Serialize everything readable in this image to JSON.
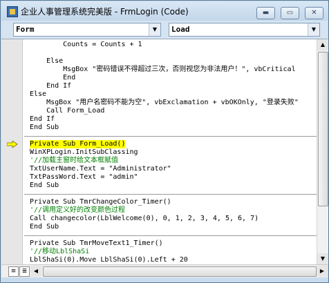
{
  "window": {
    "title": "企业人事管理系统完美版 - FrmLogin (Code)",
    "buttons": {
      "minimize": "▬",
      "restore": "▭",
      "close": "✕"
    }
  },
  "combos": {
    "object": {
      "value": "Form",
      "arrow": "▼"
    },
    "procedure": {
      "value": "Load",
      "arrow": "▼"
    }
  },
  "code_lines": [
    {
      "text": "        Counts = Counts + 1",
      "style": ""
    },
    {
      "text": "",
      "style": ""
    },
    {
      "text": "    Else",
      "style": ""
    },
    {
      "text": "        MsgBox \"密码错误不得超过三次，否则视您为非法用户！\", vbCritical",
      "style": ""
    },
    {
      "text": "        End",
      "style": ""
    },
    {
      "text": "    End If",
      "style": ""
    },
    {
      "text": "Else",
      "style": ""
    },
    {
      "text": "    MsgBox \"用户名密码不能为空\", vbExclamation + vbOKOnly, \"登录失败\"",
      "style": ""
    },
    {
      "text": "    Call Form_Load",
      "style": ""
    },
    {
      "text": "End If",
      "style": ""
    },
    {
      "text": "End Sub",
      "style": ""
    },
    {
      "text": "",
      "style": "sep"
    },
    {
      "text": "Private Sub Form_Load()",
      "style": "hl"
    },
    {
      "text": "WinXPLogin.InitSubClassing",
      "style": ""
    },
    {
      "text": "'//加载主窗时给文本框赋值",
      "style": "green"
    },
    {
      "text": "TxtUserName.Text = \"Administrator\"",
      "style": ""
    },
    {
      "text": "TxtPassWord.Text = \"admin\"",
      "style": ""
    },
    {
      "text": "End Sub",
      "style": ""
    },
    {
      "text": "",
      "style": "sep"
    },
    {
      "text": "Private Sub TmrChangeColor_Timer()",
      "style": ""
    },
    {
      "text": "'//调用定义好的改变颜色过程",
      "style": "green"
    },
    {
      "text": "Call changecolor(LblWelcome(0), 0, 1, 2, 3, 4, 5, 6, 7)",
      "style": ""
    },
    {
      "text": "End Sub",
      "style": ""
    },
    {
      "text": "",
      "style": "sep"
    },
    {
      "text": "Private Sub TmrMoveText1_Timer()",
      "style": ""
    },
    {
      "text": "'//移动LblShaSi",
      "style": "green"
    },
    {
      "text": "LblShaSi(0).Move LblShaSi(0).Left + 20",
      "style": ""
    }
  ],
  "scroll": {
    "up": "▲",
    "down": "▼",
    "left": "◀",
    "right": "▶"
  },
  "colors": {
    "keyword": "#00008b",
    "comment": "#008000",
    "highlight": "#ffff00",
    "arrow": "#ffff00"
  }
}
